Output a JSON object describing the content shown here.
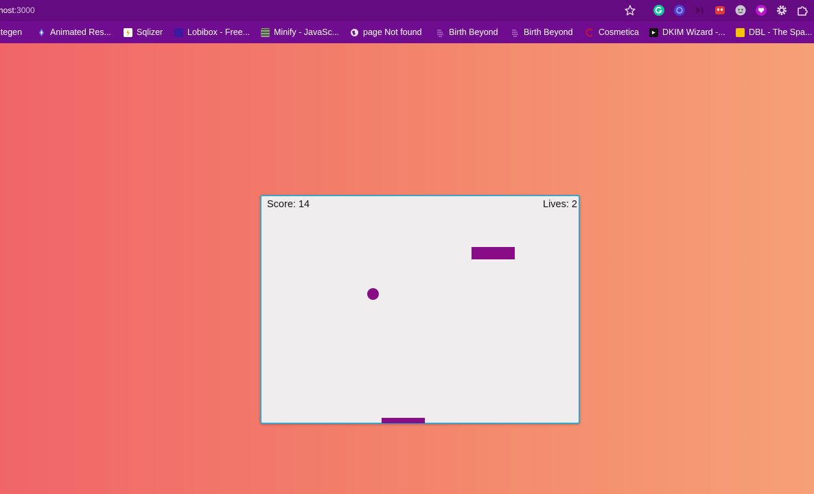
{
  "browser": {
    "url_host": "host",
    "url_port": ":3000",
    "bookmarks": [
      {
        "label": "itegen",
        "icon": "none"
      },
      {
        "label": "Animated Res...",
        "icon": "diamond-icon"
      },
      {
        "label": "Sqlizer",
        "icon": "sqlizer-icon"
      },
      {
        "label": "Lobibox - Free...",
        "icon": "square-icon"
      },
      {
        "label": "Minify - JavaSc...",
        "icon": "minify-icon"
      },
      {
        "label": "page Not found",
        "icon": "globe-icon"
      },
      {
        "label": "Birth Beyond",
        "icon": "birth-beyond-icon"
      },
      {
        "label": "Birth Beyond",
        "icon": "birth-beyond-icon"
      },
      {
        "label": "Cosmetica",
        "icon": "cosmetica-icon"
      },
      {
        "label": "DKIM Wizard -...",
        "icon": "dkim-icon"
      },
      {
        "label": "DBL - The Spa...",
        "icon": "dbl-icon"
      }
    ],
    "extensions": [
      "grammarly-icon",
      "circle-extension-icon",
      "dark-extension-icon",
      "red-extension-icon",
      "face-extension-icon",
      "heart-extension-icon",
      "gear-icon",
      "puzzle-icon"
    ]
  },
  "game": {
    "score_text": "Score: 14",
    "lives_text": "Lives: 2",
    "colors": {
      "board": "#efedee",
      "border": "#3ba6c9",
      "ball": "#880c85",
      "paddle": "#880c85",
      "brick": "#880c85"
    }
  }
}
